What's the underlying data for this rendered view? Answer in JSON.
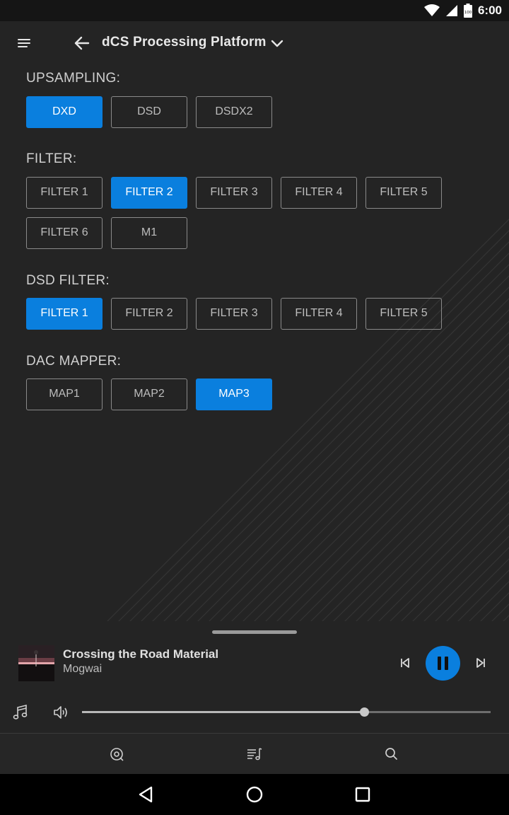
{
  "status_bar": {
    "time": "6:00",
    "battery": "100"
  },
  "header": {
    "title": "dCS Processing Platform"
  },
  "sections": {
    "upsampling": {
      "label": "UPSAMPLING:",
      "options": [
        "DXD",
        "DSD",
        "DSDX2"
      ],
      "selected": "DXD"
    },
    "filter": {
      "label": "FILTER:",
      "options": [
        "FILTER 1",
        "FILTER 2",
        "FILTER 3",
        "FILTER 4",
        "FILTER 5",
        "FILTER 6",
        "M1"
      ],
      "selected": "FILTER 2"
    },
    "dsd_filter": {
      "label": "DSD FILTER:",
      "options": [
        "FILTER 1",
        "FILTER 2",
        "FILTER 3",
        "FILTER 4",
        "FILTER 5"
      ],
      "selected": "FILTER 1"
    },
    "dac_mapper": {
      "label": "DAC MAPPER:",
      "options": [
        "MAP1",
        "MAP2",
        "MAP3"
      ],
      "selected": "MAP3"
    }
  },
  "now_playing": {
    "track": "Crossing the Road Material",
    "artist": "Mogwai",
    "state": "playing",
    "volume": 0.69
  },
  "icons": {
    "menu": "menu-icon",
    "back": "arrow-left-icon",
    "dropdown": "chevron-down-icon",
    "prev": "skip-previous-icon",
    "pause": "pause-icon",
    "next": "skip-next-icon",
    "music": "music-note-icon",
    "volume": "volume-icon",
    "nav": [
      "now-playing-icon",
      "queue-icon",
      "search-icon"
    ],
    "system": [
      "back-triangle-icon",
      "home-circle-icon",
      "recents-square-icon"
    ]
  },
  "colors": {
    "accent": "#0a7fde",
    "background": "#242424"
  }
}
